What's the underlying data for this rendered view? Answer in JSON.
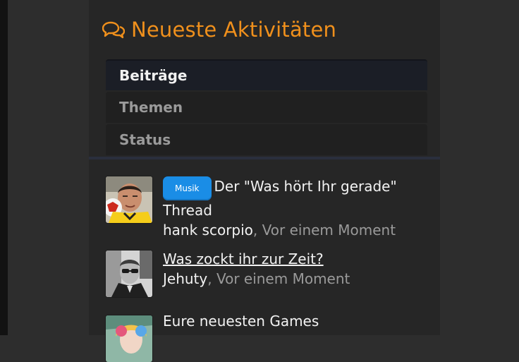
{
  "widget": {
    "title": "Neueste Aktivitäten",
    "icon": "comments-icon",
    "accent_color": "#f0901c"
  },
  "tabs": [
    {
      "label": "Beiträge",
      "active": true
    },
    {
      "label": "Themen",
      "active": false
    },
    {
      "label": "Status",
      "active": false
    }
  ],
  "activities": [
    {
      "prefix": "Musik",
      "prefix_color": "#1a8de6",
      "title": "Der \"Was hört Ihr gerade\" Thread",
      "user": "hank scorpio",
      "separator": ",",
      "time": "Vor einem Moment",
      "avatar": "soccer-player-avatar"
    },
    {
      "prefix": "",
      "title": "Was zockt ihr zur Zeit?",
      "user": "Jehuty",
      "separator": ",",
      "time": "Vor einem Moment",
      "avatar": "bw-portrait-avatar"
    },
    {
      "prefix": "",
      "title": "Eure neuesten Games",
      "user": "",
      "separator": "",
      "time": "",
      "avatar": "colorful-character-avatar"
    }
  ]
}
